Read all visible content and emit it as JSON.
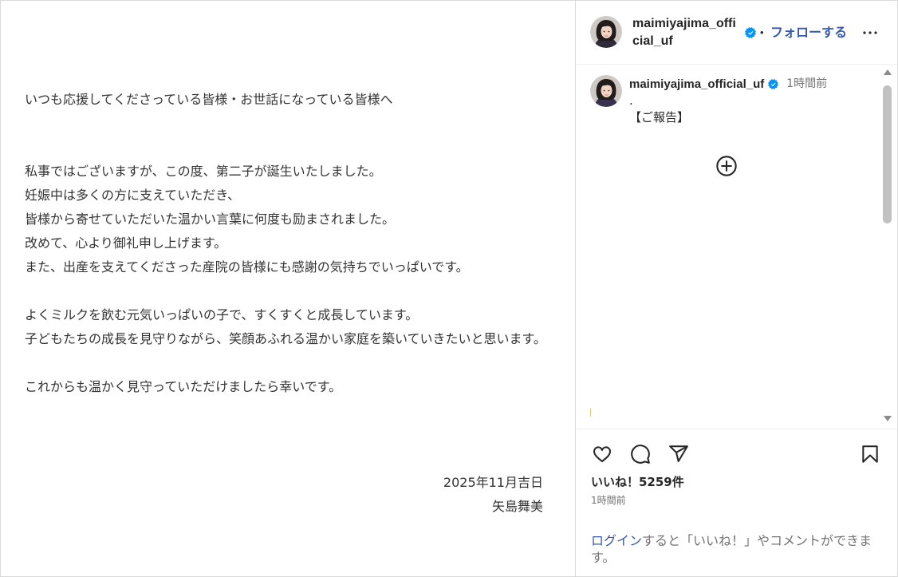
{
  "post_image": {
    "greeting": "いつも応援してくださっている皆様・お世話になっている皆様へ",
    "paragraphs": [
      [
        "私事ではございますが、この度、第二子が誕生いたしました。",
        "妊娠中は多くの方に支えていただき、",
        "皆様から寄せていただいた温かい言葉に何度も励まされました。",
        "改めて、心より御礼申し上げます。",
        "また、出産を支えてくださった産院の皆様にも感謝の気持ちでいっぱいです。"
      ],
      [
        "よくミルクを飲む元気いっぱいの子で、すくすくと成長しています。",
        "子どもたちの成長を見守りながら、笑顔あふれる温かい家庭を築いていきたいと思います。"
      ],
      [
        "これからも温かく見守っていただけましたら幸いです。"
      ]
    ],
    "date": "2025年11月吉日",
    "signature": "矢島舞美"
  },
  "header": {
    "username": "maimiyajima_official_uf",
    "verified_icon": "verified-badge-icon",
    "separator": "•",
    "follow_label": "フォローする",
    "more_icon": "more-options-icon"
  },
  "caption": {
    "username": "maimiyajima_official_uf",
    "verified_icon": "verified-badge-icon",
    "time": "1時間前",
    "lines": [
      ".",
      "【ご報告】"
    ]
  },
  "comments": {
    "load_more_icon": "plus-circle-icon"
  },
  "actions": {
    "like_icon": "heart-icon",
    "comment_icon": "comment-icon",
    "share_icon": "share-icon",
    "save_icon": "bookmark-icon"
  },
  "likes": "いいね！5259件",
  "timestamp": "1時間前",
  "login_prompt": {
    "link": "ログイン",
    "text": "すると「いいね！」やコメントができます。"
  },
  "colors": {
    "link": "#3558b0",
    "verified": "#0095f6",
    "text": "#262626",
    "secondary": "#737373",
    "border": "#dbdbdb"
  }
}
